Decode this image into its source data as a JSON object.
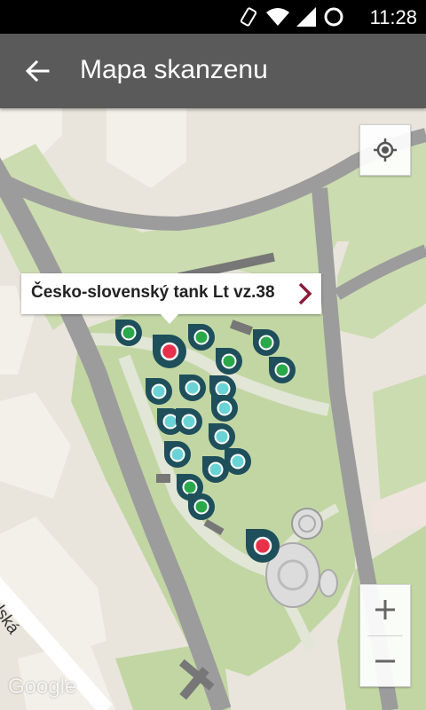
{
  "status_bar": {
    "time": "11:28"
  },
  "app_bar": {
    "title": "Mapa skanzenu"
  },
  "map": {
    "attribution": "Google",
    "street_label": "ulská",
    "callout": {
      "title": "Česko-slovenský tank Lt vz.38"
    },
    "colors": {
      "pin_body": "#1e4f5a",
      "green": "#2aa84a",
      "cyan": "#6ad3d5",
      "red": "#e8304a",
      "chevron": "#8a1c3a"
    },
    "zoom": {
      "in": "+",
      "out": "−"
    }
  }
}
